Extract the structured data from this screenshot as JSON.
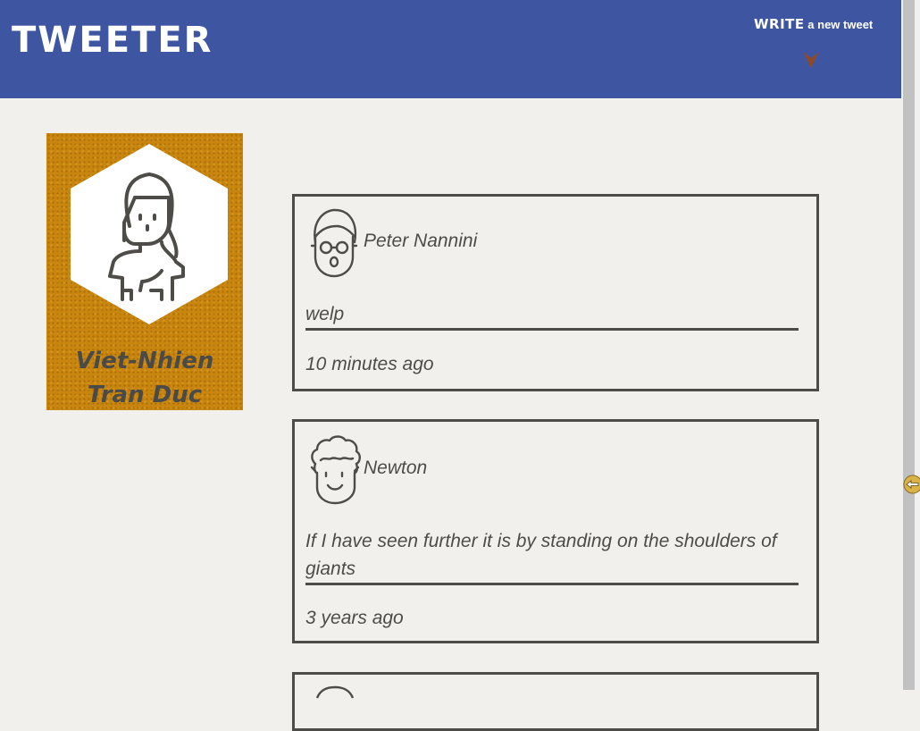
{
  "header": {
    "brand": "TWEETER",
    "compose_write": "WRITE",
    "compose_rest": "a new tweet"
  },
  "profile": {
    "name": "Viet-Nhien Tran Duc"
  },
  "tweets": [
    {
      "author": "Peter Nannini",
      "text": "welp",
      "time": "10 minutes ago",
      "avatar": "glasses-avatar-icon"
    },
    {
      "author": "Newton",
      "text": "If I have seen further it is by standing on the shoulders of giants",
      "time": "3 years ago",
      "avatar": "curly-hair-avatar-icon"
    }
  ],
  "colors": {
    "navbar": "#3e56a2",
    "page_background": "#f1f0ec",
    "profile_background": "#c9860e",
    "compose_arrow": "#8b4a2b",
    "text": "#4e4c48"
  }
}
